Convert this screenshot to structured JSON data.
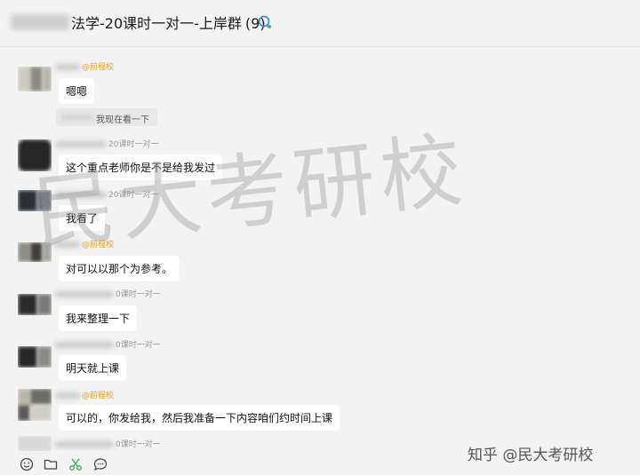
{
  "header": {
    "title": "法学-20课时一对一-上岸群",
    "member_count": "(9)"
  },
  "messages": [
    {
      "tag": "@前程校",
      "time": "",
      "text": "嗯嗯"
    },
    {
      "tag": "",
      "time": "20课时一对一",
      "text": "这个重点老师你是不是给我发过"
    },
    {
      "tag": "",
      "time": "20课时一对一",
      "text": "我看了"
    },
    {
      "tag": "@前程校",
      "time": "",
      "text": "对可以以那个为参考。"
    },
    {
      "tag": "",
      "time": "0课时一对一",
      "text": "我来整理一下"
    },
    {
      "tag": "",
      "time": "0课时一对一",
      "text": "明天就上课"
    },
    {
      "tag": "@前程校",
      "time": "",
      "text": "可以的，你发给我，然后我准备一下内容咱们约时间上课"
    },
    {
      "tag": "",
      "time": "0课时一对一",
      "text": ""
    }
  ],
  "system_notice": "我现在看一下",
  "watermark": "民大考研校",
  "credit": "知乎 @民大考研校",
  "toolbar": {
    "emoji": "emoji-icon",
    "folder": "folder-icon",
    "scissors": "scissors-icon",
    "chat": "chat-bubble-icon"
  },
  "colors": {
    "background": "#f3f3f3",
    "bubble": "#ffffff",
    "tag": "#e3a12a",
    "watermark": "#969696"
  }
}
